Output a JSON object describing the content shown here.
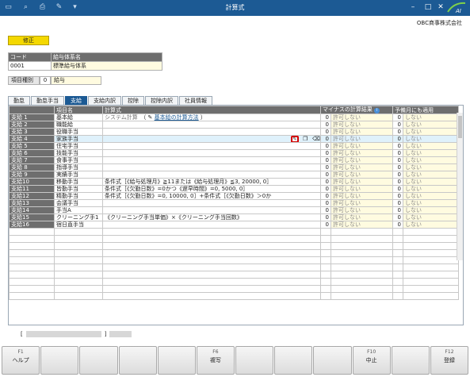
{
  "window": {
    "title": "計算式",
    "company": "OBC商事株式会社"
  },
  "mode_label": "修正",
  "system": {
    "code_label": "コード",
    "name_label": "給与体系名",
    "code": "0001",
    "name": "標準給与体系"
  },
  "item_type": {
    "label": "項目種別",
    "code": "0",
    "name": "給与"
  },
  "tabs": [
    "勤怠",
    "勤怠手当",
    "支給",
    "支給内訳",
    "控除",
    "控除内訳",
    "社員情報"
  ],
  "active_tab": "支給",
  "grid": {
    "headers": {
      "item_name": "項目名",
      "formula": "計算式",
      "negative": "マイナスの計算結果",
      "plan": "予備月にも適用"
    },
    "rows": [
      {
        "code": "支給 1",
        "name": "基本給",
        "formula": "システム計算",
        "link": "基本給の計算方法",
        "neg_num": "0",
        "neg_text": "許可しない",
        "plan_num": "0",
        "plan_text": "しない"
      },
      {
        "code": "支給 2",
        "name": "職能給",
        "formula": "",
        "neg_num": "0",
        "neg_text": "許可しない",
        "plan_num": "0",
        "plan_text": "しない"
      },
      {
        "code": "支給 3",
        "name": "役職手当",
        "formula": "",
        "neg_num": "0",
        "neg_text": "許可しない",
        "plan_num": "0",
        "plan_text": "しない"
      },
      {
        "code": "支給 4",
        "name": "家族手当",
        "formula": "",
        "neg_num": "0",
        "neg_text": "許可しない",
        "plan_num": "0",
        "plan_text": "しない"
      },
      {
        "code": "支給 5",
        "name": "住宅手当",
        "formula": "",
        "neg_num": "0",
        "neg_text": "許可しない",
        "plan_num": "0",
        "plan_text": "しない"
      },
      {
        "code": "支給 6",
        "name": "技能手当",
        "formula": "",
        "neg_num": "0",
        "neg_text": "許可しない",
        "plan_num": "0",
        "plan_text": "しない"
      },
      {
        "code": "支給 7",
        "name": "食事手当",
        "formula": "",
        "neg_num": "0",
        "neg_text": "許可しない",
        "plan_num": "0",
        "plan_text": "しない"
      },
      {
        "code": "支給 8",
        "name": "指導手当",
        "formula": "",
        "neg_num": "0",
        "neg_text": "許可しない",
        "plan_num": "0",
        "plan_text": "しない"
      },
      {
        "code": "支給 9",
        "name": "実績手当",
        "formula": "",
        "neg_num": "0",
        "neg_text": "許可しない",
        "plan_num": "0",
        "plan_text": "しない"
      },
      {
        "code": "支給10",
        "name": "移動手当",
        "formula": "条件式［《給与処理月》≧11または《給与処理月》≦3, 20000, 0］",
        "neg_num": "0",
        "neg_text": "許可しない",
        "plan_num": "0",
        "plan_text": "しない"
      },
      {
        "code": "支給11",
        "name": "皆勤手当",
        "formula": "条件式［《欠勤日数》=0かつ《遅早時間》=0, 5000, 0］",
        "neg_num": "0",
        "neg_text": "許可しない",
        "plan_num": "0",
        "plan_text": "しない"
      },
      {
        "code": "支給12",
        "name": "精勤手当",
        "formula": "条件式［《欠勤日数》=0, 10000, 0］+条件式［《欠勤日数》＞0か",
        "neg_num": "0",
        "neg_text": "許可しない",
        "plan_num": "0",
        "plan_text": "しない"
      },
      {
        "code": "支給13",
        "name": "会議手当",
        "formula": "",
        "neg_num": "0",
        "neg_text": "許可しない",
        "plan_num": "0",
        "plan_text": "しない"
      },
      {
        "code": "支給14",
        "name": "手当A",
        "formula": "",
        "neg_num": "0",
        "neg_text": "許可しない",
        "plan_num": "0",
        "plan_text": "しない"
      },
      {
        "code": "支給15",
        "name": "クリーニング手1",
        "formula": "《クリーニング手当単価》×《クリーニング手当回数》",
        "neg_num": "0",
        "neg_text": "許可しない",
        "plan_num": "0",
        "plan_text": "しない"
      },
      {
        "code": "支給16",
        "name": "宿日直手当",
        "formula": "",
        "neg_num": "0",
        "neg_text": "許可しない",
        "plan_num": "0",
        "plan_text": "しない"
      }
    ]
  },
  "status": {
    "left_bracket": "[",
    "right_bracket": "]"
  },
  "fkeys": [
    {
      "key": "F1",
      "label": "ヘルプ"
    },
    {
      "key": "",
      "label": ""
    },
    {
      "key": "",
      "label": ""
    },
    {
      "key": "",
      "label": ""
    },
    {
      "key": "",
      "label": ""
    },
    {
      "key": "F6",
      "label": "複写"
    },
    {
      "key": "",
      "label": ""
    },
    {
      "key": "",
      "label": ""
    },
    {
      "key": "",
      "label": ""
    },
    {
      "key": "F10",
      "label": "中止"
    },
    {
      "key": "",
      "label": ""
    },
    {
      "key": "F12",
      "label": "登録"
    }
  ],
  "icons": {
    "edit": "pencil-icon",
    "copy": "copy-icon",
    "erase": "eraser-icon",
    "info": "info-icon"
  },
  "colors": {
    "titlebar": "#1c5a94",
    "mode": "#f4d800",
    "highlight": "#d40000"
  }
}
